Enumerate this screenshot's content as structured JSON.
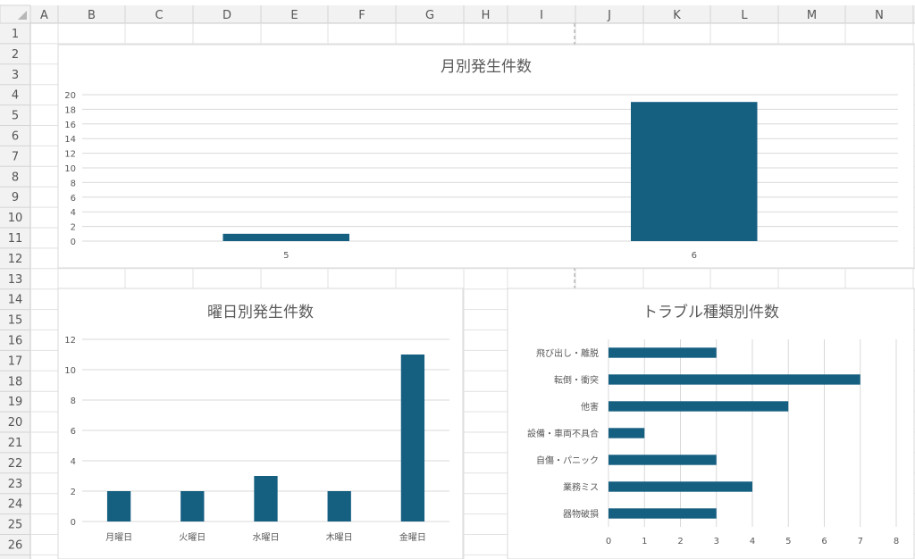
{
  "sheet": {
    "columns": [
      "A",
      "B",
      "C",
      "D",
      "E",
      "F",
      "G",
      "H",
      "I",
      "J",
      "K",
      "L",
      "M",
      "N"
    ],
    "rows": [
      "1",
      "2",
      "3",
      "4",
      "5",
      "6",
      "7",
      "8",
      "9",
      "10",
      "11",
      "12",
      "13",
      "14",
      "15",
      "16",
      "17",
      "18",
      "19",
      "20",
      "21",
      "22",
      "23",
      "24",
      "25",
      "26"
    ]
  },
  "colors": {
    "bar": "#155f81",
    "grid": "#d9d9d9",
    "header_bg": "#f2f2f2",
    "corner_bg": "#f3f3f3",
    "cell_border": "#e2e2e2"
  },
  "chart_data": [
    {
      "type": "bar",
      "title": "月別発生件数",
      "categories": [
        "5",
        "6"
      ],
      "values": [
        1,
        19
      ],
      "ylim": [
        0,
        20
      ],
      "yticks": [
        "0",
        "2",
        "4",
        "6",
        "8",
        "10",
        "12",
        "14",
        "16",
        "18",
        "20"
      ],
      "grid": true
    },
    {
      "type": "bar",
      "title": "曜日別発生件数",
      "categories": [
        "月曜日",
        "火曜日",
        "水曜日",
        "木曜日",
        "金曜日"
      ],
      "values": [
        2,
        2,
        3,
        2,
        11
      ],
      "ylim": [
        0,
        12
      ],
      "yticks": [
        "0",
        "2",
        "4",
        "6",
        "8",
        "10",
        "12"
      ],
      "grid": true
    },
    {
      "type": "bar",
      "orientation": "horizontal",
      "title": "トラブル種類別件数",
      "categories": [
        "飛び出し・離脱",
        "転倒・衝突",
        "他害",
        "設備・車両不具合",
        "自傷・パニック",
        "業務ミス",
        "器物破損"
      ],
      "values": [
        3,
        7,
        5,
        1,
        3,
        4,
        3
      ],
      "xlim": [
        0,
        8
      ],
      "xticks": [
        "0",
        "1",
        "2",
        "3",
        "4",
        "5",
        "6",
        "7",
        "8"
      ],
      "grid": true
    }
  ]
}
